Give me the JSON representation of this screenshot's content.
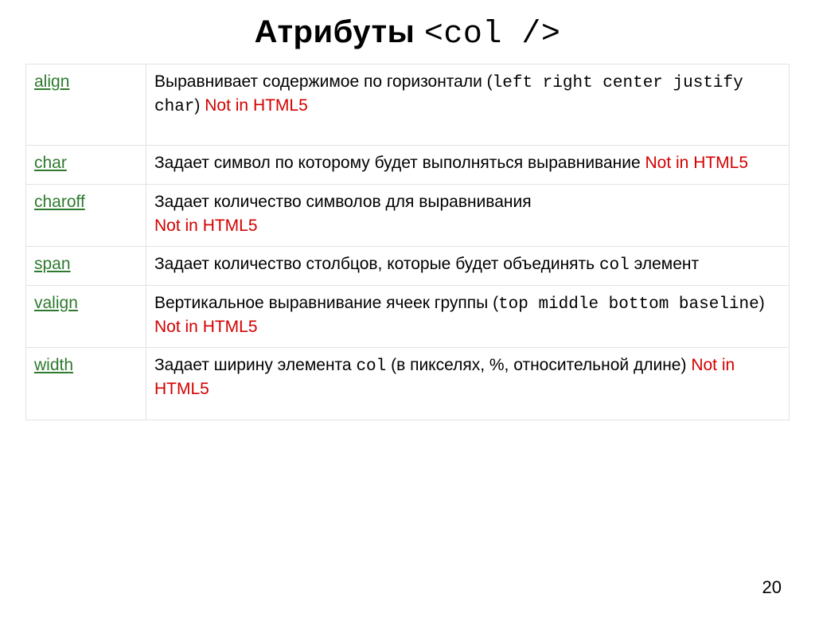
{
  "title_bold": "Атрибуты",
  "title_code": "<col />",
  "page_number": "20",
  "rows": [
    {
      "name": "align",
      "desc_pre": "Выравнивает содержимое по горизонтали (",
      "code": "left right center justify char",
      "desc_post": ") ",
      "warn": "Not in HTML5"
    },
    {
      "name": "char",
      "desc_pre": "Задает символ по которому будет выполняться выравнивание ",
      "code": "",
      "desc_post": "",
      "warn": "Not in HTML5"
    },
    {
      "name": "charoff",
      "desc_pre": "Задает количество символов для выравнивания",
      "code": "",
      "desc_post": "",
      "warn": "Not in HTML5"
    },
    {
      "name": "span",
      "desc_pre": "Задает количество столбцов, которые будет объединять ",
      "code": "col",
      "desc_post": " элемент",
      "warn": ""
    },
    {
      "name": "valign",
      "desc_pre": "Вертикальное выравнивание ячеек группы (",
      "code": "top middle bottom baseline",
      "desc_post": ") ",
      "warn": "Not in HTML5"
    },
    {
      "name": "width",
      "desc_pre": "Задает ширину элемента ",
      "code": "col",
      "desc_post": " (в пикселях, %, относительной длине) ",
      "warn": "Not in HTML5"
    }
  ]
}
